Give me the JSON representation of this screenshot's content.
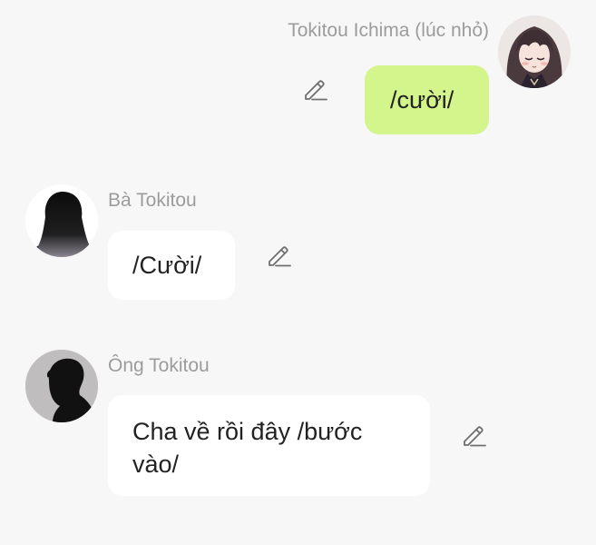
{
  "messages": [
    {
      "sender": "Tokitou Ichima (lúc nhỏ)",
      "text": "/cười/",
      "direction": "outgoing",
      "bubble_color": "#d4f58c",
      "avatar_icon": "anime-girl-avatar-icon",
      "edit_icon": "pencil-icon"
    },
    {
      "sender": "Bà Tokitou",
      "text": "/Cười/",
      "direction": "incoming",
      "bubble_color": "#ffffff",
      "avatar_icon": "woman-silhouette-avatar-icon",
      "edit_icon": "pencil-icon"
    },
    {
      "sender": "Ông Tokitou",
      "text": "Cha về rồi đây /bước vào/",
      "direction": "incoming",
      "bubble_color": "#ffffff",
      "avatar_icon": "man-silhouette-avatar-icon",
      "edit_icon": "pencil-icon"
    }
  ],
  "theme": {
    "background": "#f7f7f7",
    "name_color": "#9c9c9c",
    "text_color": "#222222",
    "icon_color": "#6f6f6f"
  }
}
